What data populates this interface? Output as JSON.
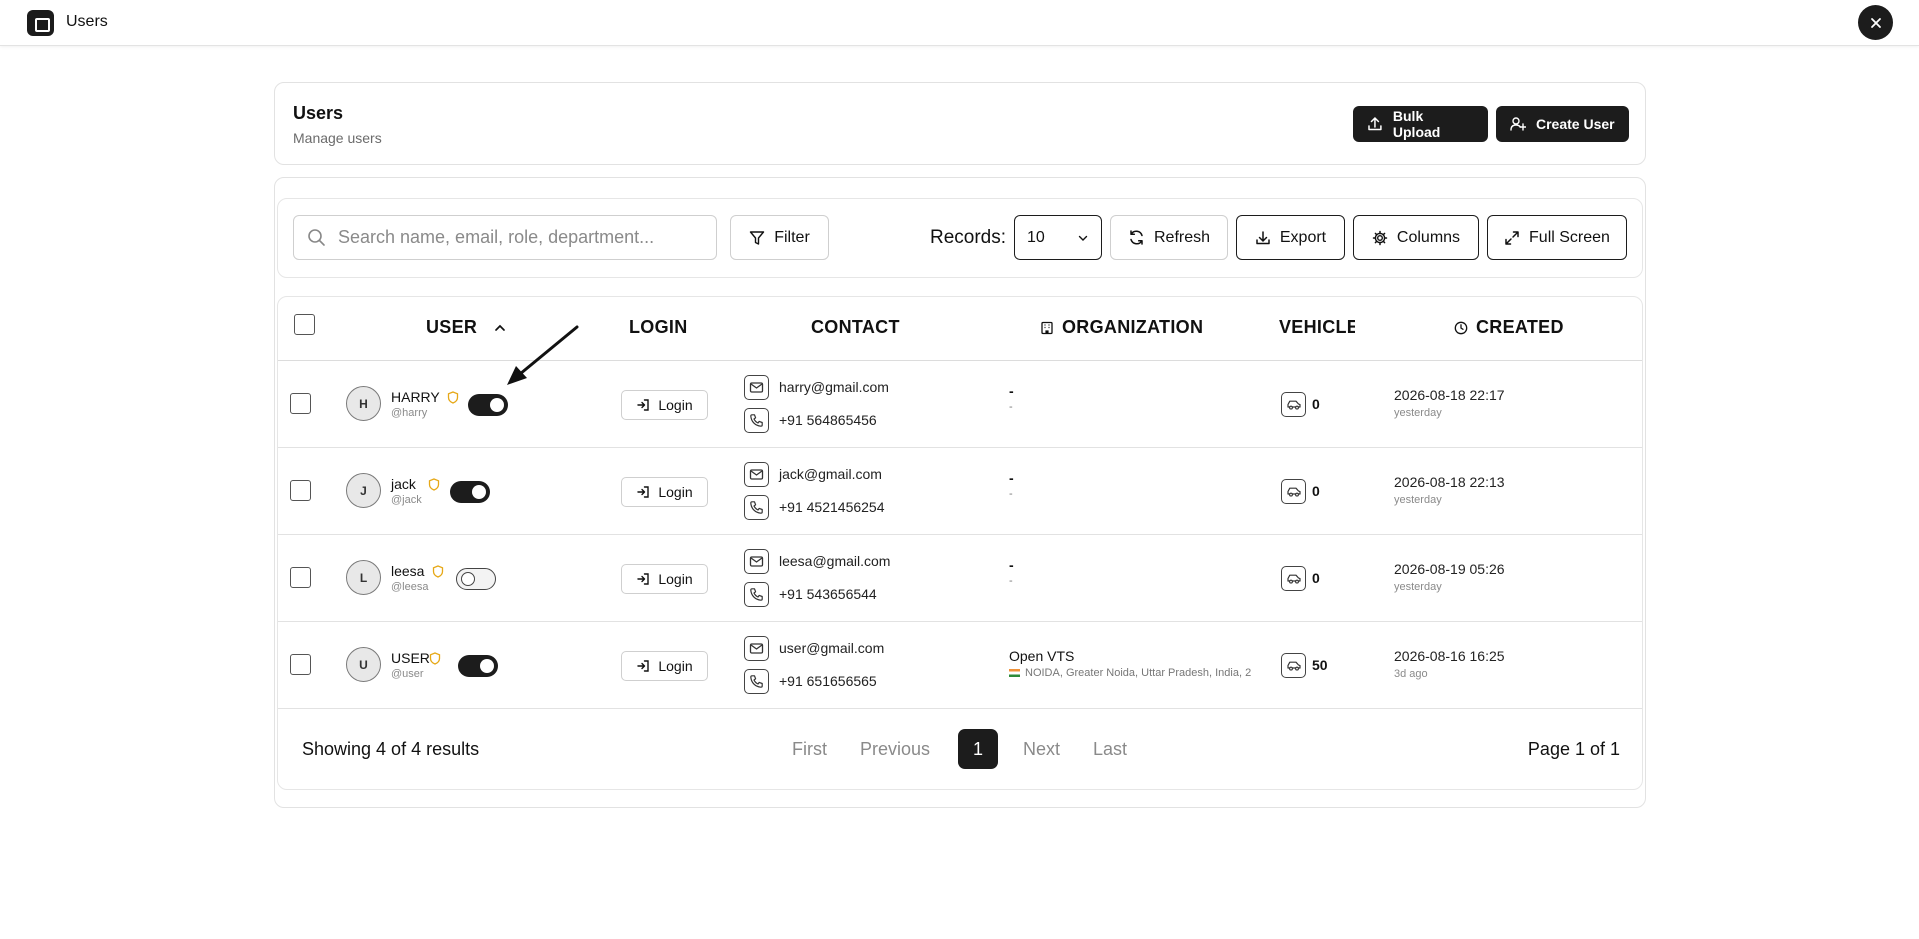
{
  "topbar": {
    "title": "Users"
  },
  "header": {
    "title": "Users",
    "subtitle": "Manage users",
    "bulk_upload_label": "Bulk Upload",
    "create_user_label": "Create User"
  },
  "toolbar": {
    "search_placeholder": "Search name, email, role, department...",
    "filter_label": "Filter",
    "records_label": "Records:",
    "records_value": "10",
    "refresh_label": "Refresh",
    "export_label": "Export",
    "columns_label": "Columns",
    "fullscreen_label": "Full Screen"
  },
  "columns": {
    "user": "USER",
    "login": "LOGIN",
    "contact": "CONTACT",
    "organization": "ORGANIZATION",
    "vehicle": "VEHICLE",
    "created": "CREATED"
  },
  "rows": [
    {
      "initial": "H",
      "name": "HARRY",
      "handle": "@harry",
      "active": true,
      "login_label": "Login",
      "email": "harry@gmail.com",
      "phone": "+91 564865456",
      "org_name": "-",
      "org_sub": "-",
      "vehicles": "0",
      "created": "2026-08-18 22:17",
      "created_rel": "yesterday"
    },
    {
      "initial": "J",
      "name": "jack",
      "handle": "@jack",
      "active": true,
      "login_label": "Login",
      "email": "jack@gmail.com",
      "phone": "+91 4521456254",
      "org_name": "-",
      "org_sub": "-",
      "vehicles": "0",
      "created": "2026-08-18 22:13",
      "created_rel": "yesterday"
    },
    {
      "initial": "L",
      "name": "leesa",
      "handle": "@leesa",
      "active": false,
      "login_label": "Login",
      "email": "leesa@gmail.com",
      "phone": "+91 543656544",
      "org_name": "-",
      "org_sub": "-",
      "vehicles": "0",
      "created": "2026-08-19 05:26",
      "created_rel": "yesterday"
    },
    {
      "initial": "U",
      "name": "USER",
      "handle": "@user",
      "active": true,
      "login_label": "Login",
      "email": "user@gmail.com",
      "phone": "+91 651656565",
      "org_name": "Open VTS",
      "org_sub": "NOIDA, Greater Noida, Uttar Pradesh, India, 2",
      "vehicles": "50",
      "created": "2026-08-16 16:25",
      "created_rel": "3d ago"
    }
  ],
  "footer": {
    "showing": "Showing 4 of 4 results",
    "first": "First",
    "previous": "Previous",
    "current_page": "1",
    "next": "Next",
    "last": "Last",
    "page_of": "Page 1 of 1"
  },
  "colors": {
    "primary": "#1c1c1c",
    "warning_icon": "#e6a817",
    "border": "#e2e2e2"
  },
  "icons": [
    "app-icon",
    "close-icon",
    "upload-icon",
    "user-plus-icon",
    "search-icon",
    "filter-icon",
    "chevron-down-icon",
    "refresh-icon",
    "download-icon",
    "gear-icon",
    "expand-icon",
    "sort-up-icon",
    "building-icon",
    "clock-icon",
    "shield-icon",
    "login-icon",
    "mail-icon",
    "phone-icon",
    "car-icon"
  ]
}
